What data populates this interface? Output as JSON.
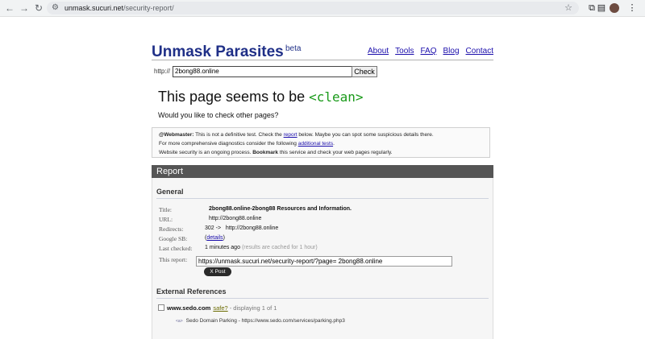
{
  "browser": {
    "url_host": "unmask.sucuri.net",
    "url_path": "/security-report/"
  },
  "header": {
    "logo": "Unmask Parasites",
    "beta": "beta",
    "nav": [
      "About",
      "Tools",
      "FAQ",
      "Blog",
      "Contact"
    ]
  },
  "form": {
    "prefix": "http://",
    "url_value": "2bong88.online",
    "check_label": "Check"
  },
  "verdict": {
    "text": "This page seems to be",
    "status": "<clean>",
    "question": "Would you like to check other pages?"
  },
  "notice": {
    "webmaster_label": "@Webmaster:",
    "line1_a": " This is not a definitive test. Check the ",
    "line1_link": "report",
    "line1_b": " below. Maybe you can spot some suspicious details there.",
    "line2_a": "For more comprehensive diagnostics consider the following ",
    "line2_link": "additional tests",
    "line2_b": ".",
    "line3_a": "Website security is an ongoing process. ",
    "line3_bold": "Bookmark",
    "line3_b": " this service and check your web pages regularly."
  },
  "report": {
    "title": "Report",
    "general_heading": "General",
    "rows": {
      "title_label": "Title:",
      "title_value": "2bong88.online-2bong88 Resources and Information.",
      "url_label": "URL:",
      "url_value": "http://2bong88.online",
      "redirects_label": "Redirects:",
      "redirects_code": "302 ->",
      "redirects_target": "http://2bong88.online",
      "google_label": "Google SB:",
      "google_open": "(",
      "google_link": "details",
      "google_close": ")",
      "checked_label": "Last checked:",
      "checked_value": "1 minutes ago",
      "checked_note": "(results are cached for 1 hour)",
      "report_label": "This report:",
      "report_value": "https://unmask.sucuri.net/security-report/?page= 2bong88.online"
    },
    "xpost": "X Post",
    "ext_heading": "External References",
    "ext": {
      "domain": "www.sedo.com",
      "safe": "safe?",
      "displaying": "- displaying 1 of 1",
      "tag": "<a>",
      "sub_title": "Sedo Domain Parking",
      "sub_sep": " - ",
      "sub_url": "https://www.sedo.com/services/parking.php3"
    }
  }
}
